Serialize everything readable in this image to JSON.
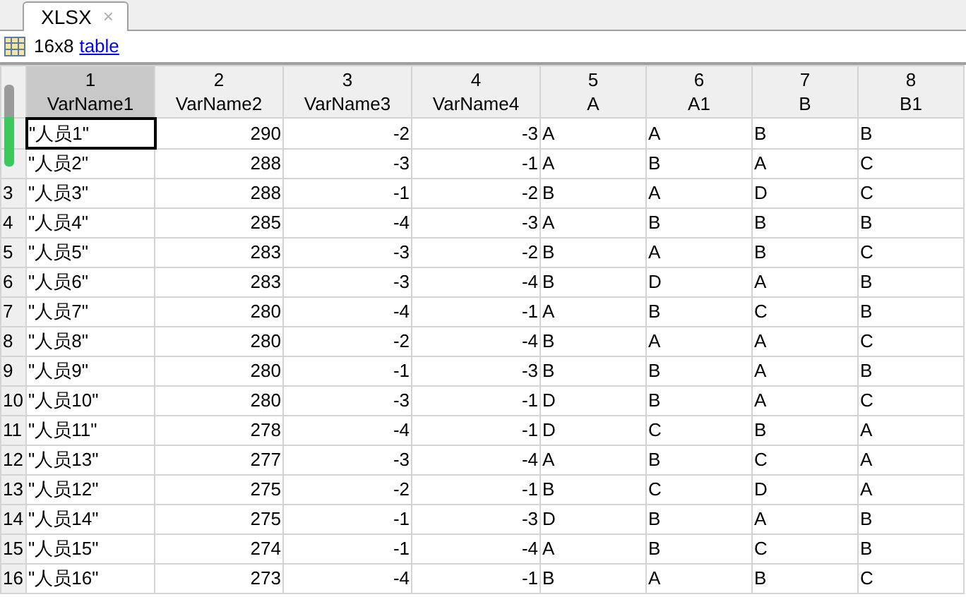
{
  "tabs": [
    {
      "label": "XLSX",
      "selected": true,
      "close": "×"
    }
  ],
  "toolbar": {
    "size": "16x8",
    "type_link": "table"
  },
  "columns": [
    {
      "index": "1",
      "name": "VarName1",
      "selected": true,
      "kind": "text"
    },
    {
      "index": "2",
      "name": "VarName2",
      "selected": false,
      "kind": "number"
    },
    {
      "index": "3",
      "name": "VarName3",
      "selected": false,
      "kind": "number"
    },
    {
      "index": "4",
      "name": "VarName4",
      "selected": false,
      "kind": "number"
    },
    {
      "index": "5",
      "name": "A",
      "selected": false,
      "kind": "text"
    },
    {
      "index": "6",
      "name": "A1",
      "selected": false,
      "kind": "text"
    },
    {
      "index": "7",
      "name": "B",
      "selected": false,
      "kind": "text"
    },
    {
      "index": "8",
      "name": "B1",
      "selected": false,
      "kind": "text"
    }
  ],
  "rows": [
    {
      "selected": true,
      "cells": [
        "\"人员1\"",
        "290",
        "-2",
        "-3",
        "A",
        "A",
        "B",
        "B"
      ]
    },
    {
      "selected": false,
      "cells": [
        "\"人员2\"",
        "288",
        "-3",
        "-1",
        "A",
        "B",
        "A",
        "C"
      ]
    },
    {
      "number": "3",
      "selected": false,
      "cells": [
        "\"人员3\"",
        "288",
        "-1",
        "-2",
        "B",
        "A",
        "D",
        "C"
      ]
    },
    {
      "number": "4",
      "selected": false,
      "cells": [
        "\"人员4\"",
        "285",
        "-4",
        "-3",
        "A",
        "B",
        "B",
        "B"
      ]
    },
    {
      "number": "5",
      "selected": false,
      "cells": [
        "\"人员5\"",
        "283",
        "-3",
        "-2",
        "B",
        "A",
        "B",
        "C"
      ]
    },
    {
      "number": "6",
      "selected": false,
      "cells": [
        "\"人员6\"",
        "283",
        "-3",
        "-4",
        "B",
        "D",
        "A",
        "B"
      ]
    },
    {
      "number": "7",
      "selected": false,
      "cells": [
        "\"人员7\"",
        "280",
        "-4",
        "-1",
        "A",
        "B",
        "C",
        "B"
      ]
    },
    {
      "number": "8",
      "selected": false,
      "cells": [
        "\"人员8\"",
        "280",
        "-2",
        "-4",
        "B",
        "A",
        "A",
        "C"
      ]
    },
    {
      "number": "9",
      "selected": false,
      "cells": [
        "\"人员9\"",
        "280",
        "-1",
        "-3",
        "B",
        "B",
        "A",
        "B"
      ]
    },
    {
      "number": "10",
      "selected": false,
      "cells": [
        "\"人员10\"",
        "280",
        "-3",
        "-1",
        "D",
        "B",
        "A",
        "C"
      ]
    },
    {
      "number": "11",
      "selected": false,
      "cells": [
        "\"人员11\"",
        "278",
        "-4",
        "-1",
        "D",
        "C",
        "B",
        "A"
      ]
    },
    {
      "number": "12",
      "selected": false,
      "cells": [
        "\"人员13\"",
        "277",
        "-3",
        "-4",
        "A",
        "B",
        "C",
        "A"
      ]
    },
    {
      "number": "13",
      "selected": false,
      "cells": [
        "\"人员12\"",
        "275",
        "-2",
        "-1",
        "B",
        "C",
        "D",
        "A"
      ]
    },
    {
      "number": "14",
      "selected": false,
      "cells": [
        "\"人员14\"",
        "275",
        "-1",
        "-3",
        "D",
        "B",
        "A",
        "B"
      ]
    },
    {
      "number": "15",
      "selected": false,
      "cells": [
        "\"人员15\"",
        "274",
        "-1",
        "-4",
        "A",
        "B",
        "C",
        "B"
      ]
    },
    {
      "number": "16",
      "selected": false,
      "cells": [
        "\"人员16\"",
        "273",
        "-4",
        "-1",
        "B",
        "A",
        "B",
        "C"
      ]
    }
  ]
}
